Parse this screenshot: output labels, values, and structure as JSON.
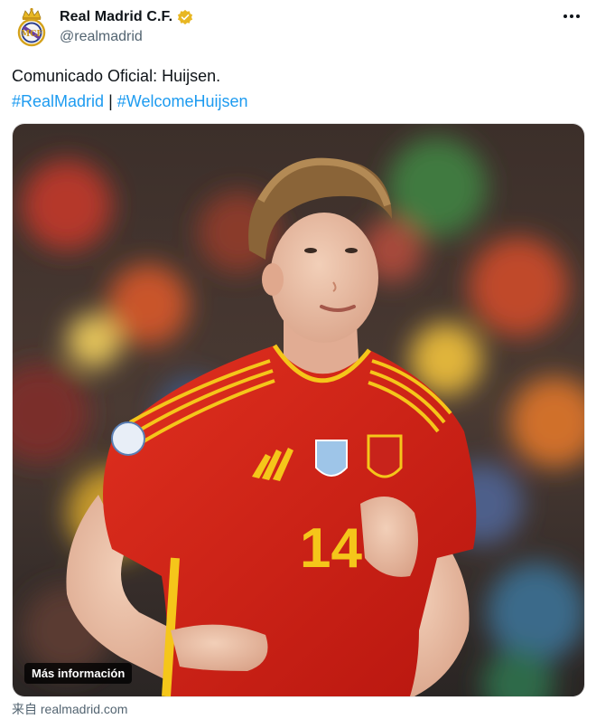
{
  "account": {
    "display_name": "Real Madrid C.F.",
    "handle": "@realmadrid",
    "verified_icon": "verified-badge-gold",
    "avatar_icon": "real-madrid-crest"
  },
  "post": {
    "text": "Comunicado Oficial: Huijsen.",
    "hashtags": [
      "#RealMadrid",
      "#WelcomeHuijsen"
    ],
    "separator": "|"
  },
  "media": {
    "description_button": "Más información",
    "jersey_number": "14"
  },
  "source": "来自 realmadrid.com",
  "colors": {
    "link": "#1d9bf0",
    "muted": "#536471",
    "verified": "#e8b723",
    "jersey_red": "#d6231b",
    "jersey_yellow": "#f5c61a"
  }
}
